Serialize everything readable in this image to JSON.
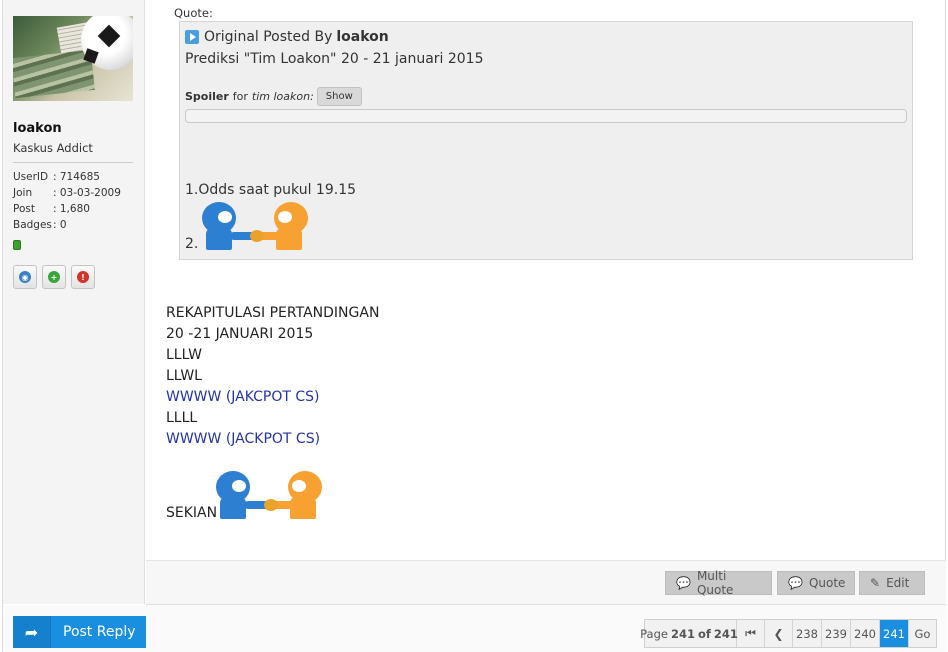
{
  "user": {
    "username": "loakon",
    "title": "Kaskus Addict",
    "stats": [
      {
        "key": "UserID",
        "value": ": 714685"
      },
      {
        "key": "Join",
        "value": ": 03-03-2009"
      },
      {
        "key": "Post",
        "value": ": 1,680"
      },
      {
        "key": "Badges",
        "value": ": 0"
      }
    ]
  },
  "quote": {
    "label": "Quote:",
    "original_prefix": "Original Posted By",
    "original_author": "loakon",
    "title": "Prediksi \"Tim Loakon\" 20 - 21 januari 2015",
    "spoiler_label": "Spoiler",
    "spoiler_for": "for",
    "spoiler_name": "tim loakon:",
    "spoiler_button": "Show",
    "odds": "1.Odds saat pukul 19.15",
    "item2": "2."
  },
  "body": {
    "lines": [
      "REKAPITULASI PERTANDINGAN",
      "20 -21 JANUARI 2015",
      "LLLW",
      "LLWL",
      "WWWW (JAKCPOT CS)",
      "LLLL",
      "WWWW (JACKPOT CS)"
    ],
    "closing": "SEKIAN"
  },
  "post_actions": {
    "multi_quote": "Multi Quote",
    "quote": "Quote",
    "edit": "Edit"
  },
  "reply_button": "Post Reply",
  "pager": {
    "page_label": "Page",
    "current": "241",
    "of_label": "of",
    "total": "241",
    "pages": [
      "238",
      "239",
      "240"
    ],
    "current_page": "241",
    "go": "Go"
  },
  "colors": {
    "accent": "#1a8fe0",
    "link": "#2532a9",
    "online": "#3aa12c"
  }
}
